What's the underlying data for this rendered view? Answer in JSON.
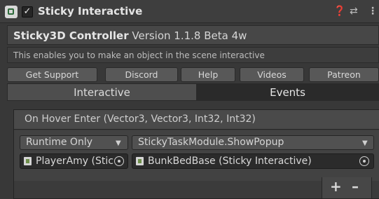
{
  "header": {
    "enabled_check": "✓",
    "title": "Sticky Interactive",
    "help_icon": "help-icon",
    "settings_icon": "preset-icon",
    "menu_icon": "kebab-menu-icon"
  },
  "version_bar": {
    "name": "Sticky3D Controller",
    "version": "Version 1.1.8 Beta 4w"
  },
  "description": "This enables you to make an object in the scene interactive",
  "buttons": [
    "Get Support",
    "Discord",
    "Help",
    "Videos",
    "Patreon"
  ],
  "tabs": [
    {
      "label": "Interactive",
      "active": false
    },
    {
      "label": "Events",
      "active": true
    }
  ],
  "event": {
    "title": "On Hover Enter (Vector3, Vector3, Int32, Int32)",
    "runtime_option": "Runtime Only",
    "function": "StickyTaskModule.ShowPopup",
    "target_object": "PlayerAmy (Stic",
    "argument_object": "BunkBedBase (Sticky Interactive)",
    "add_label": "+",
    "remove_label": "–"
  },
  "colors": {
    "background": "#383838",
    "active_tab": "#4e4e4e",
    "inactive_tab": "#2a2a2a",
    "object_icon": "#6e8f4b"
  }
}
